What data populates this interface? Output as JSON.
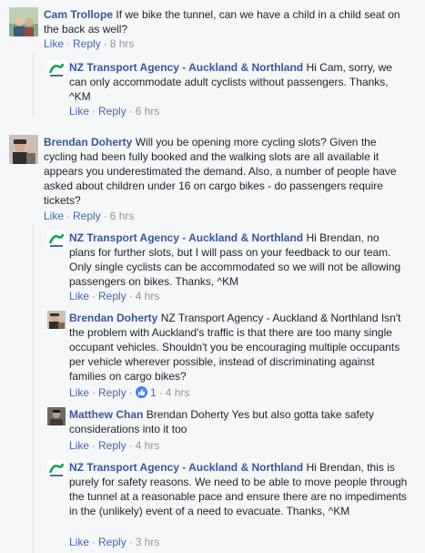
{
  "labels": {
    "like": "Like",
    "reply": "Reply",
    "sep": "·"
  },
  "comments": [
    {
      "author": "Cam Trollope",
      "text": "If we bike the tunnel, can we have a child in a child seat on the back as well?",
      "time": "8 hrs"
    },
    {
      "author": "NZ Transport Agency - Auckland & Northland",
      "text": "Hi Cam, sorry, we can only accommodate adult cyclists without passengers. Thanks, ^KM",
      "time": "6 hrs"
    },
    {
      "author": "Brendan Doherty",
      "text": "Will you be opening more cycling slots? Given the cycling had been fully booked and the walking slots are all available it appears you underestimated the demand. Also, a number of people have asked about children under 16 on cargo bikes - do passengers require tickets?",
      "time": "6 hrs"
    },
    {
      "author": "NZ Transport Agency - Auckland & Northland",
      "text": "Hi Brendan, no plans for further slots, but I will pass on your feedback to our team. Only single cyclists can be accommodated so we will not be allowing passengers on bikes. Thanks, ^KM",
      "time": "4 hrs"
    },
    {
      "author": "Brendan Doherty",
      "mention": "NZ Transport Agency - Auckland & Northland",
      "text": "Isn't the problem with Auckland's traffic is that there are too many single occupant vehicles. Shouldn't you be encouraging multiple occupants per vehicle wherever possible, instead of discriminating against families on cargo bikes?",
      "likes": "1",
      "time": "4 hrs"
    },
    {
      "author": "Matthew Chan",
      "mention": "Brendan Doherty",
      "text": "Yes but also gotta take safety considerations into it too",
      "time": "4 hrs"
    },
    {
      "author": "NZ Transport Agency - Auckland & Northland",
      "text": "Hi Brendan, this is purely for safety reasons. We need to be able to move people through the tunnel at a reasonable pace and ensure there are no impediments in the (unlikely) event of a need to evacuate. Thanks, ^KM",
      "time": "3 hrs"
    }
  ],
  "colors": {
    "author": "#365899",
    "link": "#4267b2",
    "meta": "#90949c",
    "background": "#f6f7f9",
    "nzta_logo": "#00a651"
  }
}
